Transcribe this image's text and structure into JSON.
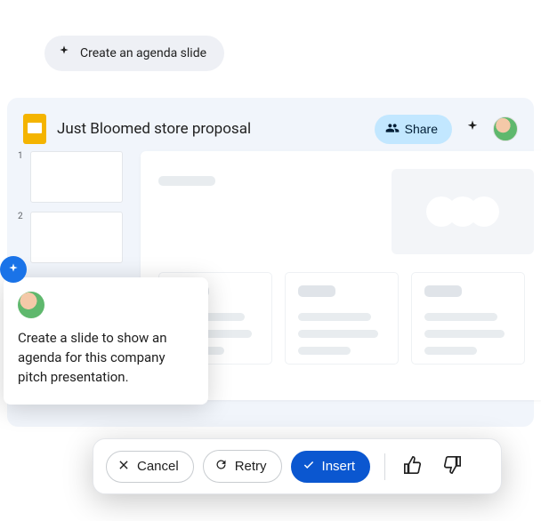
{
  "suggestion": {
    "label": "Create an agenda slide"
  },
  "document": {
    "title": "Just Bloomed store proposal"
  },
  "header": {
    "share_label": "Share"
  },
  "thumbnails": [
    {
      "num": "1"
    },
    {
      "num": "2"
    }
  ],
  "prompt": {
    "text": "Create a slide to show an agenda for this company pitch presentation."
  },
  "actions": {
    "cancel": "Cancel",
    "retry": "Retry",
    "insert": "Insert"
  }
}
